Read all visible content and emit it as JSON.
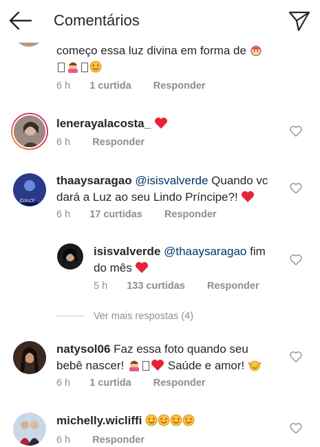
{
  "header": {
    "title": "Comentários"
  },
  "comments": [
    {
      "text": "começo essa luz divina em forma de",
      "time": "6 h",
      "likes": "1 curtida",
      "reply": "Responder"
    },
    {
      "username": "lenerayalacosta_",
      "time": "6 h",
      "reply": "Responder"
    },
    {
      "username": "thaaysaragao",
      "mention": "@isisvalverde",
      "text_line1": " Quando vc",
      "text_line2": "dará a Luz ao seu Lindo Príncipe?!",
      "time": "6 h",
      "likes": "17 curtidas",
      "reply": "Responder"
    },
    {
      "username": "isisvalverde",
      "mention": "@thaaysaragao",
      "text_line1": " fim",
      "text_line2": "do mês",
      "time": "5 h",
      "likes": "133 curtidas",
      "reply": "Responder"
    },
    {
      "username": "natysol06",
      "text_line1": " Faz essa foto quando seu",
      "text_line2a": "bebê nascer!",
      "text_line2b": " Saúde e amor!",
      "time": "6 h",
      "likes": "1 curtida",
      "reply": "Responder"
    },
    {
      "username": "michelly.wicliffi",
      "time": "6 h",
      "reply": "Responder"
    }
  ],
  "more_replies": "Ver mais respostas (4)",
  "colors": {
    "heart_red": "#ed4956",
    "meta_gray": "#8e8e8e",
    "mention_blue": "#003569"
  }
}
